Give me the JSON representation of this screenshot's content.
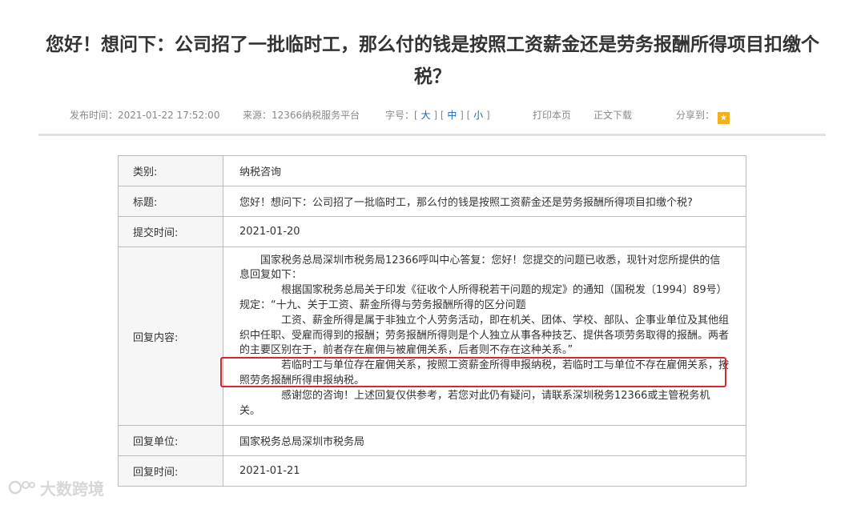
{
  "article": {
    "title": "您好！想问下：公司招了一批临时工，那么付的钱是按照工资薪金还是劳务报酬所得项目扣缴个税？"
  },
  "meta": {
    "publish_time": "发布时间：2021-01-22 17:52:00",
    "source": "来源：12366纳税服务平台",
    "font_size_label": "字号：",
    "size_large": "大",
    "size_medium": "中",
    "size_small": "小",
    "print": "打印本页",
    "download": "正文下载",
    "share_label": "分享到："
  },
  "table": {
    "category_label": "类别:",
    "category_value": "纳税咨询",
    "title_label": "标题:",
    "title_value": "您好！想问下：公司招了一批临时工，那么付的钱是按照工资薪金还是劳务报酬所得项目扣缴个税?",
    "submit_label": "提交时间:",
    "submit_value": "2021-01-20",
    "reply_label": "回复内容:",
    "reply_paragraphs": [
      "国家税务总局深圳市税务局12366呼叫中心答复：您好！您提交的问题已收悉，现针对您所提供的信息回复如下：",
      "根据国家税务总局关于印发《征收个人所得税若干问题的规定》的通知（国税发〔1994〕89号）规定：“十九、关于工资、薪金所得与劳务报酬所得的区分问题",
      "工资、薪金所得是属于非独立个人劳务活动，即在机关、团体、学校、部队、企事业单位及其他组织中任职、受雇而得到的报酬；劳务报酬所得则是个人独立从事各种技艺、提供各项劳务取得的报酬。两者的主要区别在于，前者存在雇佣与被雇佣关系，后者则不存在这种关系。”",
      "若临时工与单位存在雇佣关系，按照工资薪金所得申报纳税，若临时工与单位不存在雇佣关系，按照劳务报酬所得申报纳税。",
      "感谢您的咨询！上述回复仅供参考，若您对此仍有疑问，请联系深圳税务12366或主管税务机关。"
    ],
    "unit_label": "回复单位:",
    "unit_value": "国家税务总局深圳市税务局",
    "reply_time_label": "回复时间:",
    "reply_time_value": "2021-01-21"
  },
  "watermark": {
    "text": "大数跨境"
  },
  "share_icons": [
    "qzone-icon",
    "wechat-icon",
    "weibo-icon",
    "qq-icon"
  ],
  "colors": {
    "link": "#1a62b8",
    "highlight": "#d9262a"
  }
}
